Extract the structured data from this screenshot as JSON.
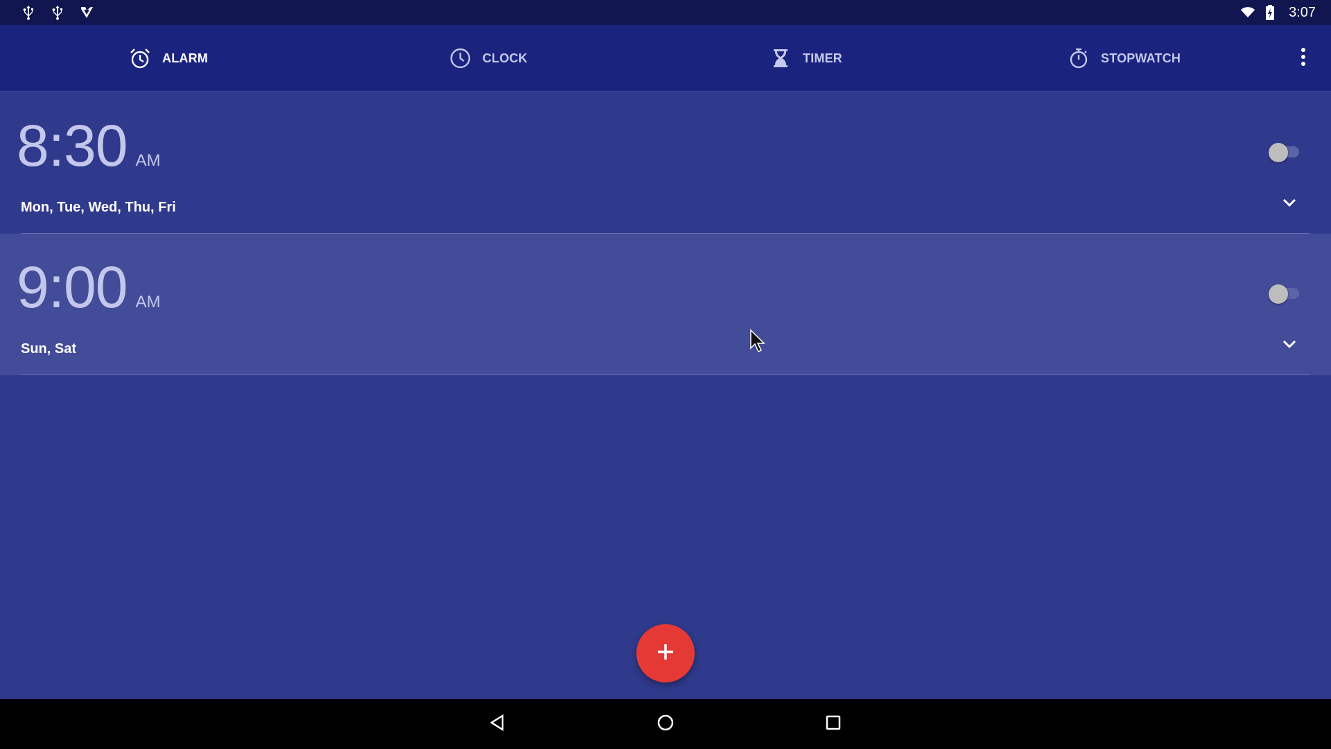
{
  "status_bar": {
    "time": "3:07",
    "left_icons": [
      "usb-icon",
      "usb-icon",
      "play-store-icon"
    ],
    "right_icons": [
      "wifi-icon",
      "battery-icon"
    ]
  },
  "tabs": [
    {
      "label": "ALARM",
      "icon": "alarm-clock-icon",
      "active": true
    },
    {
      "label": "CLOCK",
      "icon": "clock-icon",
      "active": false
    },
    {
      "label": "TIMER",
      "icon": "hourglass-icon",
      "active": false
    },
    {
      "label": "STOPWATCH",
      "icon": "stopwatch-icon",
      "active": false
    }
  ],
  "alarms": [
    {
      "time": "8:30",
      "ampm": "AM",
      "days": "Mon, Tue, Wed, Thu, Fri",
      "enabled": false
    },
    {
      "time": "9:00",
      "ampm": "AM",
      "days": "Sun, Sat",
      "enabled": false
    }
  ],
  "fab": {
    "label": "+",
    "icon": "plus-icon"
  },
  "colors": {
    "status_bar": "#111650",
    "tab_bar": "#1a237e",
    "background": "#303a8c",
    "highlight_row": "#434c98",
    "fab": "#e53935"
  }
}
